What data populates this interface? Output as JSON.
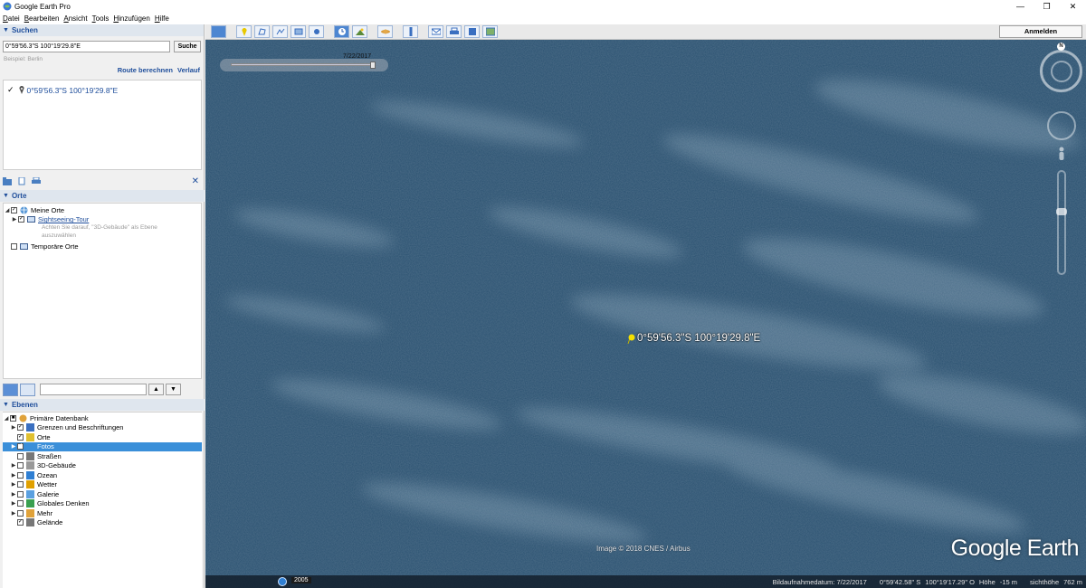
{
  "window": {
    "title": "Google Earth Pro",
    "controls": [
      "—",
      "❐",
      "✕"
    ]
  },
  "menu": [
    {
      "u": "D",
      "rest": "atei"
    },
    {
      "u": "B",
      "rest": "earbeiten"
    },
    {
      "u": "A",
      "rest": "nsicht"
    },
    {
      "u": "T",
      "rest": "ools"
    },
    {
      "u": "H",
      "rest": "inzufügen"
    },
    {
      "u": "H",
      "rest": "ilfe"
    }
  ],
  "search": {
    "header": "Suchen",
    "value": "0°59'56.3\"S 100°19'29.8\"E",
    "button": "Suche",
    "example": "Beispiel: Berlin",
    "route_link": "Route berechnen",
    "history_link": "Verlauf",
    "result": "0°59'56.3\"S 100°19'29.8\"E"
  },
  "places": {
    "header": "Orte",
    "my_places": "Meine Orte",
    "sightseeing": "Sightseeing-Tour",
    "hint_line1": "Achten Sie darauf, \"3D-Gebäude\" als Ebene",
    "hint_line2": "auszuwählen",
    "temporary": "Temporäre Orte"
  },
  "layers": {
    "header": "Ebenen",
    "primary": "Primäre Datenbank",
    "items": [
      {
        "label": "Grenzen und Beschriftungen",
        "checked": "✓",
        "expand": "▶"
      },
      {
        "label": "Orte",
        "checked": "✓",
        "expand": ""
      },
      {
        "label": "Fotos",
        "checked": "✓",
        "expand": "▶"
      },
      {
        "label": "Straßen",
        "checked": "",
        "expand": ""
      },
      {
        "label": "3D-Gebäude",
        "checked": "",
        "expand": "▶"
      },
      {
        "label": "Ozean",
        "checked": "",
        "expand": "▶"
      },
      {
        "label": "Wetter",
        "checked": "",
        "expand": "▶"
      },
      {
        "label": "Galerie",
        "checked": "",
        "expand": "▶"
      },
      {
        "label": "Globales Denken",
        "checked": "",
        "expand": "▶"
      },
      {
        "label": "Mehr",
        "checked": "",
        "expand": "▶"
      },
      {
        "label": "Gelände",
        "checked": "✓",
        "expand": ""
      }
    ]
  },
  "toolbar": {
    "signin": "Anmelden"
  },
  "map": {
    "timeslider_date": "7/22/2017",
    "placemark_label": "0°59'56.3\"S 100°19'29.8\"E",
    "compass_north": "N",
    "copyright": "Image © 2018 CNES / Airbus",
    "logo": "Google Earth"
  },
  "status": {
    "year": "2005",
    "imagery_date": "Bildaufnahmedatum: 7/22/2017",
    "lat": "0°59'42.58\" S",
    "lon": "100°19'17.29\" O",
    "elev_label": "Höhe",
    "elev_value": "-15 m",
    "eye_label": "sichthöhe",
    "eye_value": "762 m"
  },
  "colors": {
    "ocean": "#2d5272",
    "accent": "#1f4e9b",
    "selection": "#3a8fd9",
    "placemark": "#f5e000"
  }
}
